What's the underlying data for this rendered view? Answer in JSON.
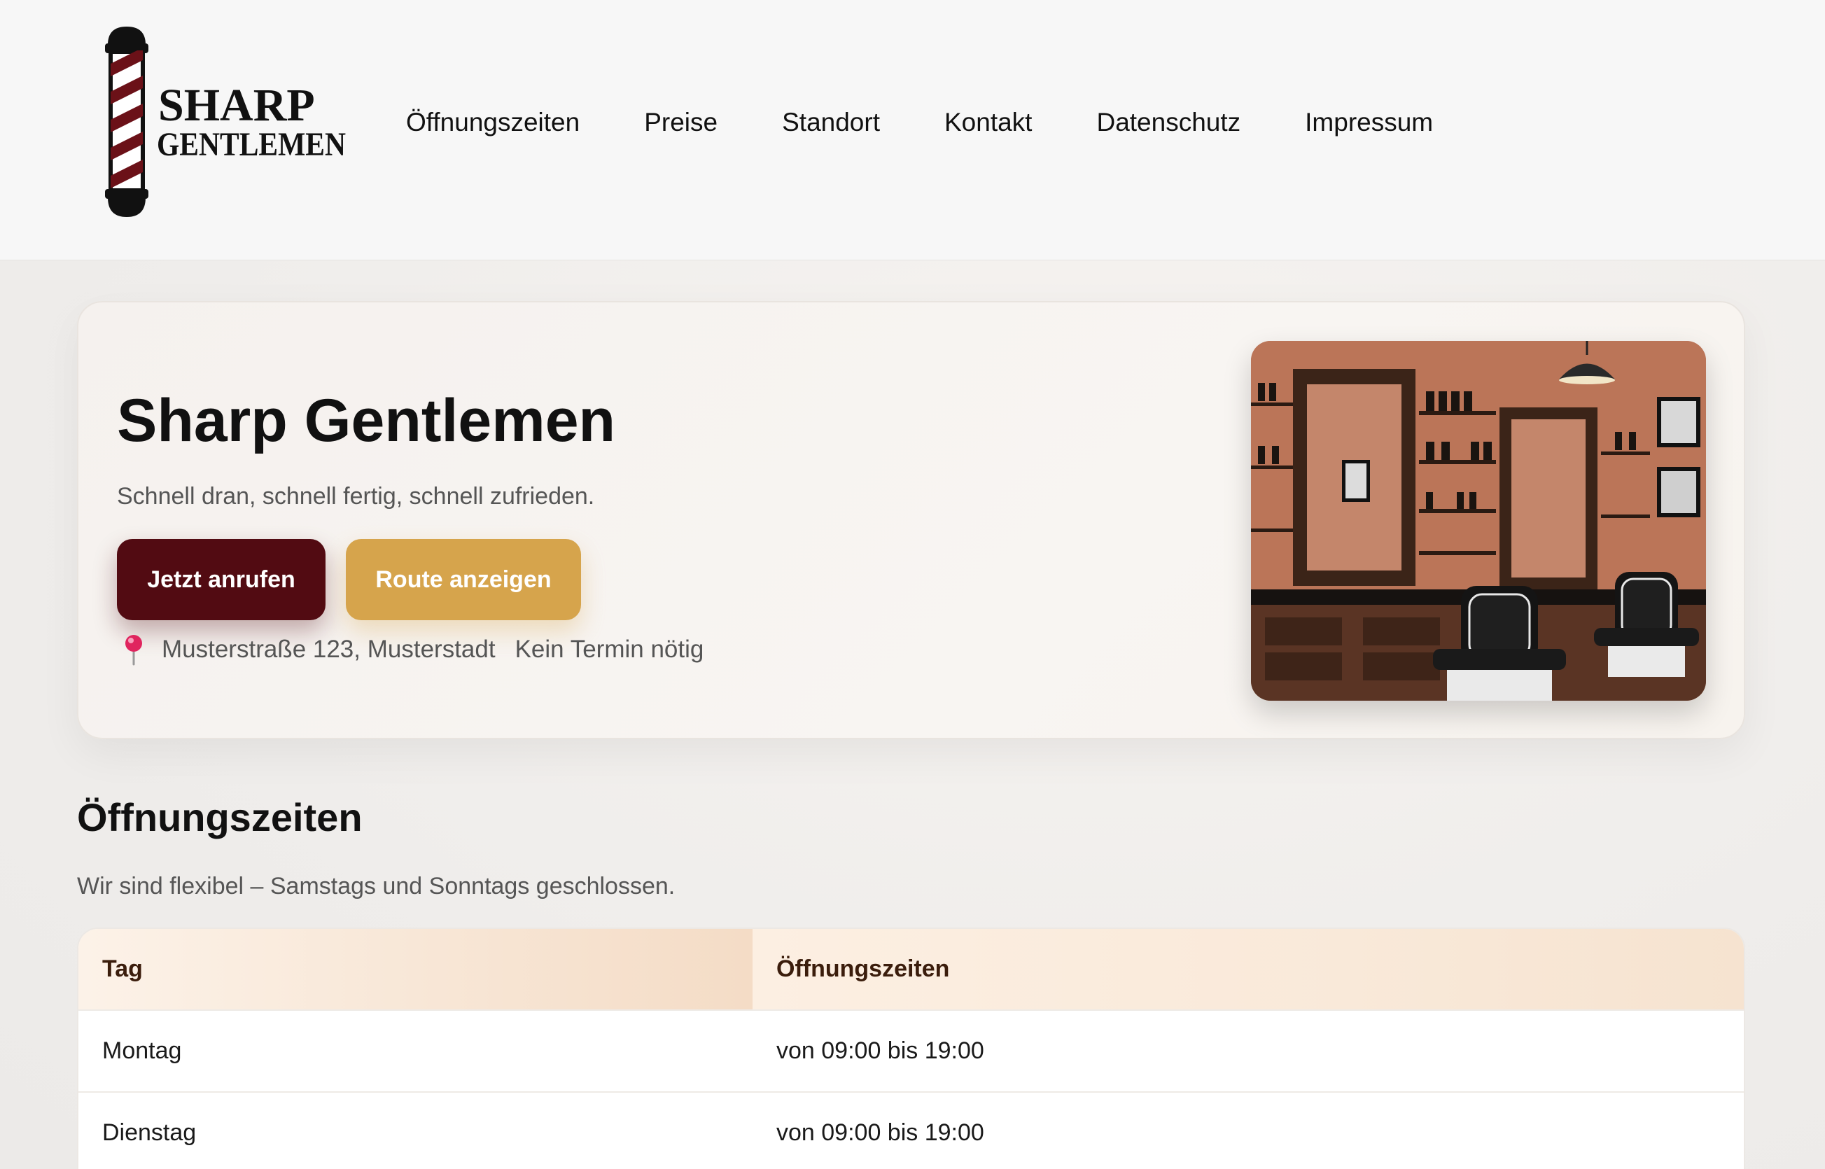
{
  "logo": {
    "line1": "SHARP",
    "line2": "GENTLEMEN"
  },
  "nav": [
    {
      "label": "Öffnungszeiten"
    },
    {
      "label": "Preise"
    },
    {
      "label": "Standort"
    },
    {
      "label": "Kontakt"
    },
    {
      "label": "Datenschutz"
    },
    {
      "label": "Impressum"
    }
  ],
  "hero": {
    "title": "Sharp Gentlemen",
    "subtitle": "Schnell dran, schnell fertig, schnell zufrieden.",
    "call_label": "Jetzt anrufen",
    "route_label": "Route anzeigen",
    "address": "Musterstraße 123, Musterstadt",
    "note": "Kein Termin nötig"
  },
  "hours": {
    "title": "Öffnungszeiten",
    "subtitle": "Wir sind flexibel – Samstags und Sonntags geschlossen.",
    "headers": {
      "day": "Tag",
      "hours": "Öffnungszeiten"
    },
    "rows": [
      {
        "day": "Montag",
        "hours": "von 09:00 bis 19:00"
      },
      {
        "day": "Dienstag",
        "hours": "von 09:00 bis 19:00"
      }
    ]
  },
  "colors": {
    "primary": "#520b12",
    "accent": "#d6a44c",
    "pin": "#e0245e"
  },
  "icons": {
    "location": "map-pin-icon"
  }
}
